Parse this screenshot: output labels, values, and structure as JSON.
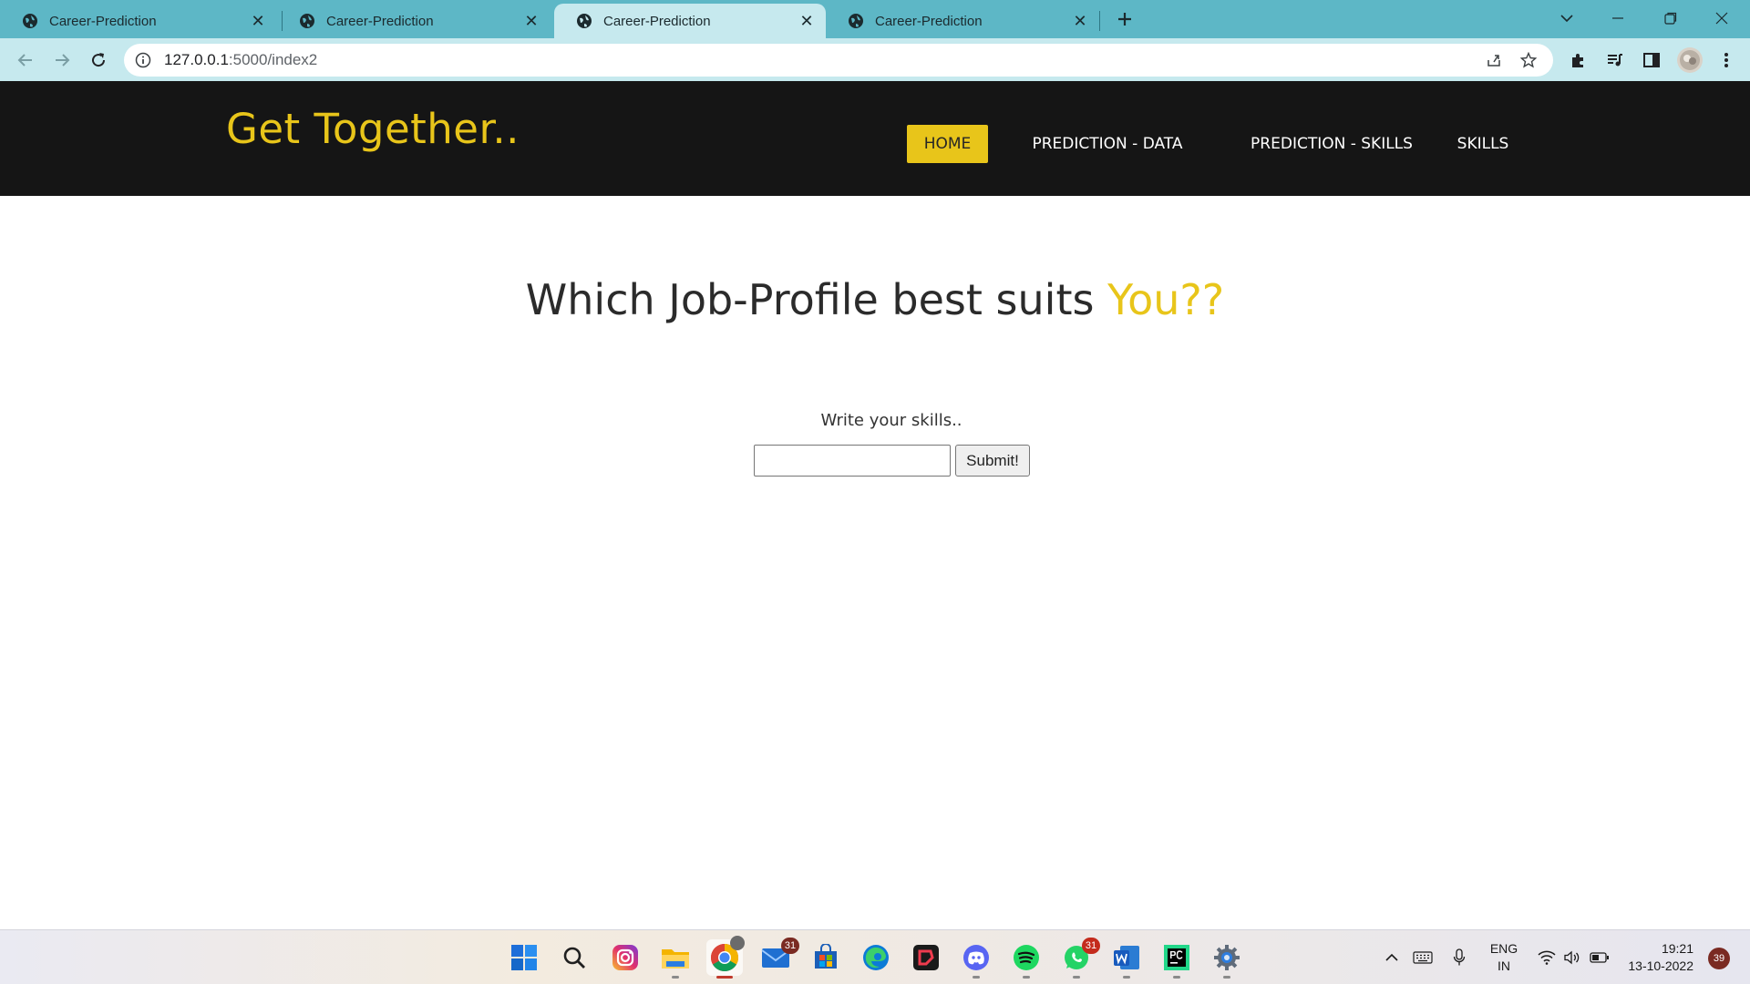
{
  "browser": {
    "tabs": [
      {
        "title": "Career-Prediction",
        "active": false
      },
      {
        "title": "Career-Prediction",
        "active": false
      },
      {
        "title": "Career-Prediction",
        "active": true
      },
      {
        "title": "Career-Prediction",
        "active": false
      }
    ],
    "url_host": "127.0.0.1",
    "url_rest": ":5000/index2"
  },
  "site": {
    "brand": "Get Together..",
    "nav": {
      "home": "HOME",
      "prediction_data": "PREDICTION - DATA",
      "prediction_skills": "PREDICTION - SKILLS",
      "skills": "SKILLS"
    },
    "headline_main": "Which Job-Profile best suits ",
    "headline_accent": "You??",
    "skills_label": "Write your skills..",
    "skills_input_value": "",
    "submit_label": "Submit!"
  },
  "taskbar": {
    "apps": [
      "start-icon",
      "search-icon",
      "instagram-icon",
      "file-explorer-icon",
      "chrome-icon",
      "mail-icon",
      "store-icon",
      "edge-icon",
      "anydesk-icon",
      "discord-icon",
      "spotify-icon",
      "whatsapp-icon",
      "word-icon",
      "pycharm-icon",
      "settings-icon"
    ],
    "mail_badge": "31",
    "whatsapp_badge": "31",
    "lang_line1": "ENG",
    "lang_line2": "IN",
    "time": "19:21",
    "date": "13-10-2022",
    "notifications": "39"
  },
  "colors": {
    "accent_yellow": "#e8c51a",
    "header_dark": "#151515",
    "tabbar": "#5db7c6",
    "toolbar": "#c6e9ee"
  }
}
